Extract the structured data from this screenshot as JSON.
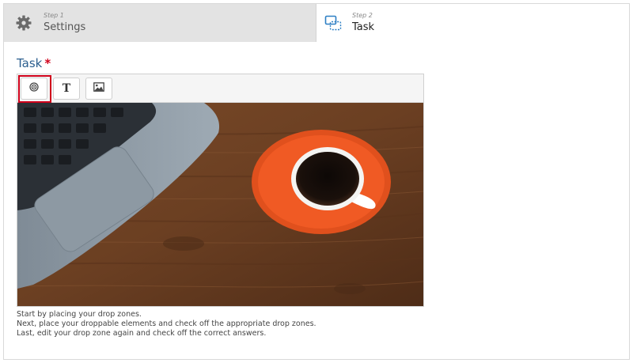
{
  "steps": [
    {
      "number": "Step 1",
      "label": "Settings",
      "icon": "gear-icon",
      "active": false
    },
    {
      "number": "Step 2",
      "label": "Task",
      "icon": "task-icon",
      "active": true
    }
  ],
  "task": {
    "title": "Task",
    "required_marker": "*"
  },
  "toolbar": {
    "tools": [
      {
        "name": "drop-zone",
        "icon": "target-icon",
        "highlighted": true
      },
      {
        "name": "text",
        "label": "T",
        "icon": "text-icon"
      },
      {
        "name": "image",
        "icon": "image-icon"
      }
    ]
  },
  "instructions": {
    "line1": "Start by placing your drop zones.",
    "line2": "Next, place your droppable elements and check off the appropriate drop zones.",
    "line3": "Last, edit your drop zone again and check off the correct answers."
  },
  "colors": {
    "title": "#2c5f8f",
    "required": "#d0021b",
    "highlight": "#d0021b",
    "inactive_tab": "#e3e3e3",
    "active_tab": "#ffffff"
  }
}
